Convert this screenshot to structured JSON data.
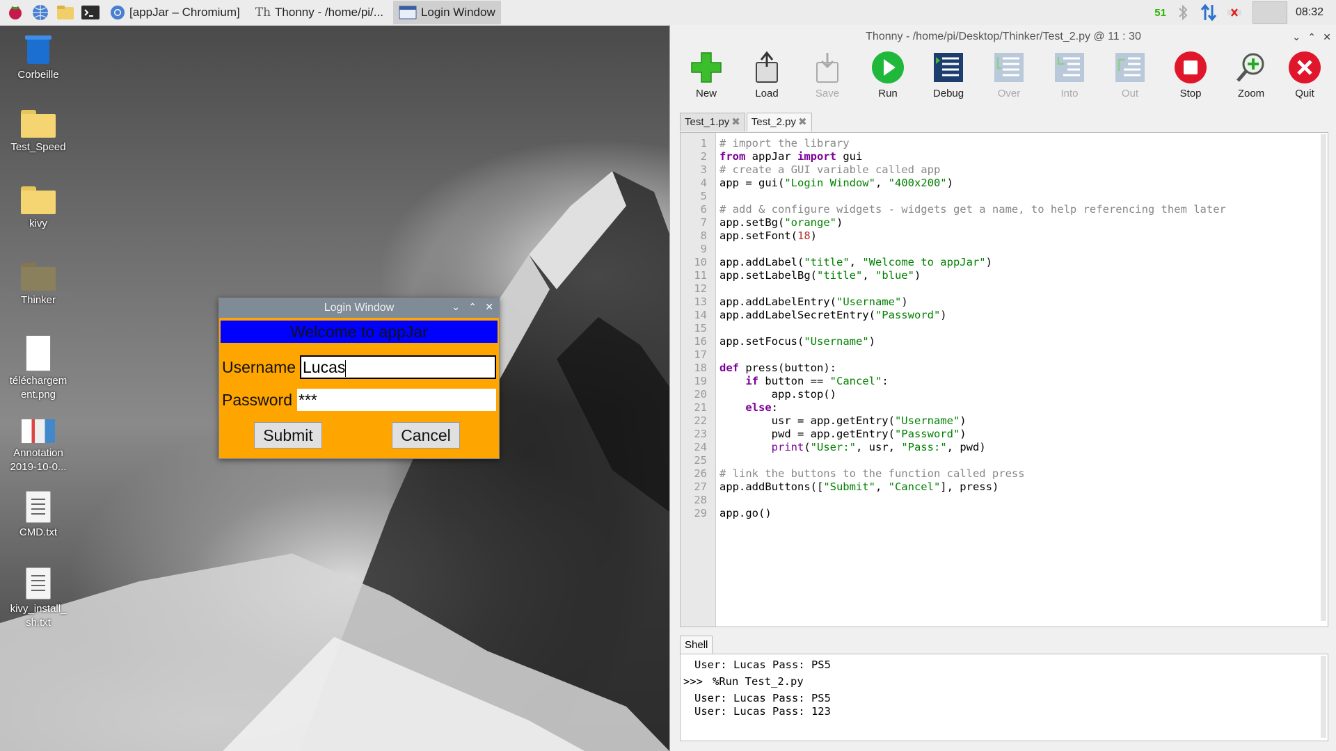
{
  "taskbar": {
    "tasks": [
      {
        "label": "[appJar – Chromium]"
      },
      {
        "label": "Thonny  -  /home/pi/..."
      },
      {
        "label": "Login Window"
      }
    ],
    "cpu": "51",
    "clock": "08:32"
  },
  "desktop": {
    "icons": [
      {
        "label": "Corbeille"
      },
      {
        "label": "Test_Speed"
      },
      {
        "label": "kivy"
      },
      {
        "label": "Thinker"
      },
      {
        "label": "téléchargem ent.png"
      },
      {
        "label": "Annotation 2019-10-0..."
      },
      {
        "label": "CMD.txt"
      },
      {
        "label": "kivy_install_ sh.txt"
      }
    ]
  },
  "login_window": {
    "title": "Login Window",
    "welcome": "Welcome to appJar",
    "username_label": "Username",
    "username_value": "Lucas",
    "password_label": "Password",
    "password_value": "***",
    "submit": "Submit",
    "cancel": "Cancel"
  },
  "thonny": {
    "title": "Thonny  -  /home/pi/Desktop/Thinker/Test_2.py  @  11 : 30",
    "toolbar": [
      {
        "label": "New",
        "enabled": true
      },
      {
        "label": "Load",
        "enabled": true
      },
      {
        "label": "Save",
        "enabled": false
      },
      {
        "label": "Run",
        "enabled": true
      },
      {
        "label": "Debug",
        "enabled": true
      },
      {
        "label": "Over",
        "enabled": false
      },
      {
        "label": "Into",
        "enabled": false
      },
      {
        "label": "Out",
        "enabled": false
      },
      {
        "label": "Stop",
        "enabled": true
      },
      {
        "label": "Zoom",
        "enabled": true
      },
      {
        "label": "Quit",
        "enabled": true
      }
    ],
    "tabs": [
      {
        "label": "Test_1.py"
      },
      {
        "label": "Test_2.py"
      }
    ],
    "code": [
      "# import the library",
      "from appJar import gui",
      "# create a GUI variable called app",
      "app = gui(\"Login Window\", \"400x200\")",
      "",
      "# add & configure widgets - widgets get a name, to help referencing them later",
      "app.setBg(\"orange\")",
      "app.setFont(18)",
      "",
      "app.addLabel(\"title\", \"Welcome to appJar\")",
      "app.setLabelBg(\"title\", \"blue\")",
      "",
      "app.addLabelEntry(\"Username\")",
      "app.addLabelSecretEntry(\"Password\")",
      "",
      "app.setFocus(\"Username\")",
      "",
      "def press(button):",
      "    if button == \"Cancel\":",
      "        app.stop()",
      "    else:",
      "        usr = app.getEntry(\"Username\")",
      "        pwd = app.getEntry(\"Password\")",
      "        print(\"User:\", usr, \"Pass:\", pwd)",
      "",
      "# link the buttons to the function called press",
      "app.addButtons([\"Submit\", \"Cancel\"], press)",
      "",
      "app.go()"
    ],
    "shell_label": "Shell",
    "shell": {
      "line1": "User: Lucas Pass: PS5",
      "prompt": ">>>",
      "command": "%Run Test_2.py",
      "line2": "User: Lucas Pass: PS5",
      "line3": "User: Lucas Pass: 123"
    }
  }
}
